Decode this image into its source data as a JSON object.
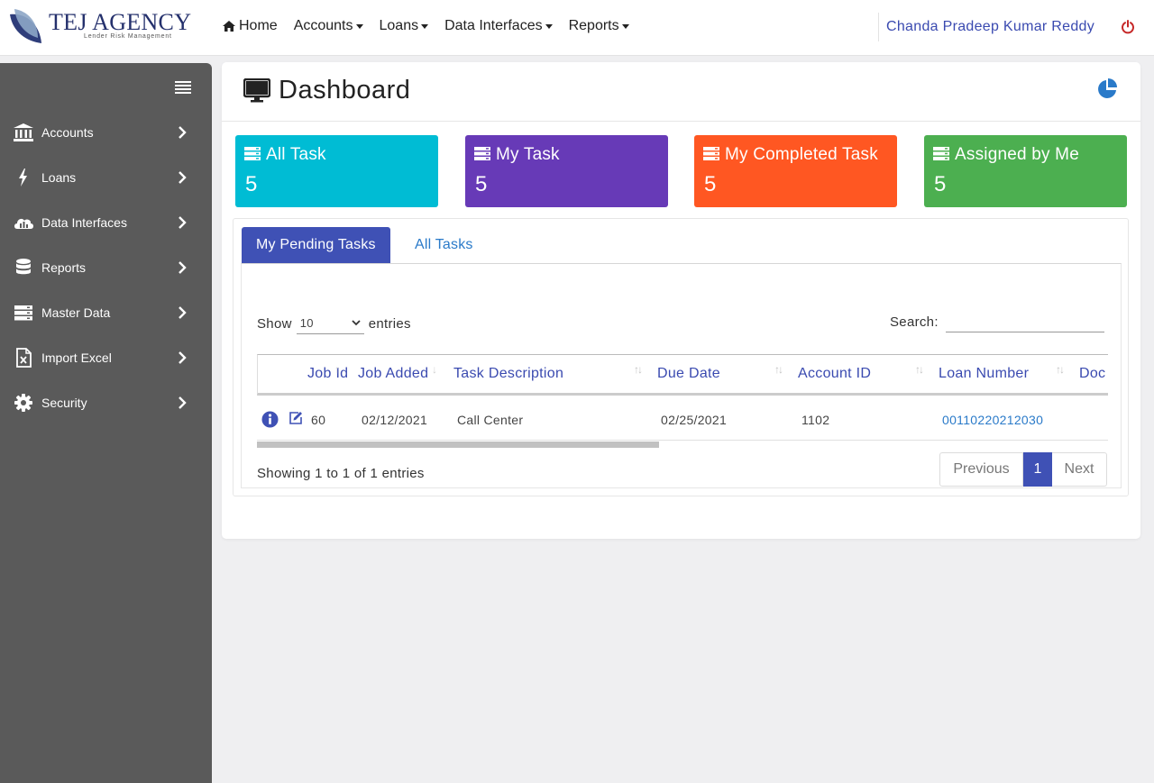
{
  "brand": {
    "name": "TEJ AGENCY",
    "tagline": "Lender Risk Management"
  },
  "nav": {
    "home": "Home",
    "items": [
      "Accounts",
      "Loans",
      "Data Interfaces",
      "Reports"
    ]
  },
  "user": {
    "name": "Chanda Pradeep Kumar Reddy"
  },
  "sidebar": {
    "items": [
      {
        "label": "Accounts",
        "icon": "bank-icon"
      },
      {
        "label": "Loans",
        "icon": "bolt-icon"
      },
      {
        "label": "Data Interfaces",
        "icon": "cloud-chart-icon"
      },
      {
        "label": "Reports",
        "icon": "database-icon"
      },
      {
        "label": "Master Data",
        "icon": "server-icon"
      },
      {
        "label": "Import Excel",
        "icon": "excel-file-icon"
      },
      {
        "label": "Security",
        "icon": "gear-icon"
      }
    ]
  },
  "page": {
    "title": "Dashboard"
  },
  "tiles": [
    {
      "label": "All Task",
      "count": "5",
      "color": "#00bcd4"
    },
    {
      "label": "My Task",
      "count": "5",
      "color": "#673ab7"
    },
    {
      "label": "My Completed Task",
      "count": "5",
      "color": "#ff5722"
    },
    {
      "label": "Assigned by Me",
      "count": "5",
      "color": "#4caf50"
    }
  ],
  "tabs": {
    "active": "My Pending Tasks",
    "other": "All Tasks"
  },
  "table_controls": {
    "show_label": "Show",
    "entries_label": "entries",
    "page_length": "10",
    "search_label": "Search:",
    "search_value": ""
  },
  "table": {
    "columns": [
      "Job Id",
      "Job Added",
      "Task Description",
      "Due Date",
      "Account ID",
      "Loan Number",
      "Doc"
    ],
    "rows": [
      {
        "job_id": "60",
        "job_added": "02/12/2021",
        "task_description": "Call Center",
        "due_date": "02/25/2021",
        "account_id": "1102",
        "loan_number": "00110220212030"
      }
    ]
  },
  "footer": {
    "info": "Showing 1 to 1 of 1 entries",
    "previous": "Previous",
    "current_page": "1",
    "next": "Next"
  },
  "colors": {
    "primary": "#3f51b5",
    "link": "#2a7ac9",
    "sidebar": "#5a5a5a",
    "power": "#c62828"
  }
}
